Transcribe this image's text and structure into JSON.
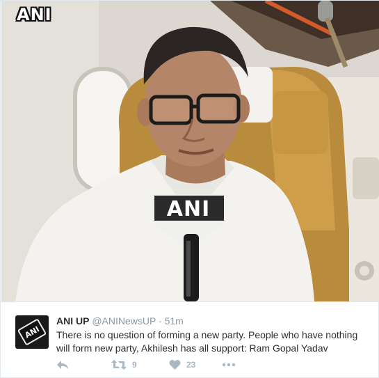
{
  "photo": {
    "watermark": "ANI",
    "mic_label": "ANI"
  },
  "tweet": {
    "author_name": "ANI UP",
    "author_handle": "@ANINewsUP",
    "separator": "·",
    "timestamp": "51m",
    "avatar_text": "ANI",
    "text": "There is no question of forming a new party. People who have nothing will form new party, Akhilesh has all support: Ram Gopal Yadav",
    "retweets": "9",
    "likes": "23"
  },
  "icons": [
    "reply-icon",
    "retweet-icon",
    "like-icon",
    "more-icon"
  ],
  "colors": {
    "icon_gray": "#aab8c2",
    "text_dark": "#292f33",
    "text_muted": "#8899a6"
  }
}
